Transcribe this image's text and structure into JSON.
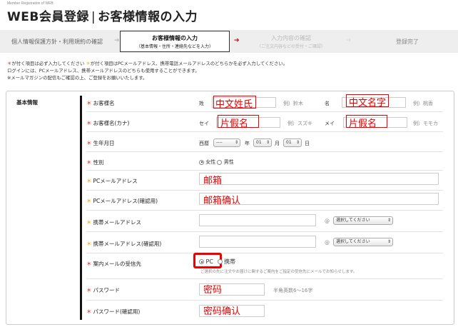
{
  "header": {
    "tiny_text": "Member Registration of WEB",
    "title_left": "WEB会員登録",
    "title_sep": "|",
    "title_right": "お客様情報の入力"
  },
  "steps": [
    {
      "label": "個人情報保護方針・利用規約の確認",
      "sub": ""
    },
    {
      "label": "お客様情報の入力",
      "sub": "（基本情報・住所・連絡先などを入力）"
    },
    {
      "label": "入力内容の確認",
      "sub": "（ご注文内容などの受付・ご確認）"
    },
    {
      "label": "登録完了",
      "sub": ""
    }
  ],
  "notes": {
    "line1_a": "が付く項目は必ず入力してください",
    "line1_b": "が付く項目はPCメールアドレス、携帯電話メールアドレスのどちらかを必ず入力してください。",
    "line2": "ログインには、PCメールアドレス、携帯メールアドレスのどちらも使用することができます。",
    "line3": "※メールマガジンの配信もご確認の上、ご登録をお願いいたします。",
    "ast": "＊"
  },
  "form": {
    "section_label": "基本情報",
    "name": {
      "label": "お客様名",
      "sei": "姓",
      "mei": "名",
      "sei_value": "中文姓氏",
      "mei_value": "中文名字",
      "sei_example": "例）鈴木",
      "mei_example": "例）桃香"
    },
    "kana": {
      "label": "お客様名(カナ)",
      "sei": "セイ",
      "mei": "メイ",
      "sei_value": "片假名",
      "mei_value": "片假名",
      "sei_example": "例）スズキ",
      "mei_example": "例）モモカ"
    },
    "birth": {
      "label": "生年月日",
      "era_label": "西暦",
      "era_value": "----",
      "year": "年",
      "month_value": "01",
      "month": "月",
      "day_value": "01",
      "day": "日"
    },
    "gender": {
      "label": "性別",
      "female": "女性",
      "male": "男性"
    },
    "pc_mail": {
      "label": "PCメールアドレス",
      "value": "邮箱"
    },
    "pc_mail_confirm": {
      "label": "PCメールアドレス(確認用)",
      "value": "邮箱确认"
    },
    "mobile_mail": {
      "label": "携帯メールアドレス",
      "at": "@",
      "select": "選択してください"
    },
    "mobile_mail_confirm": {
      "label": "携帯メールアドレス(確認用)",
      "at": "@",
      "select": "選択してください"
    },
    "receive": {
      "label": "案内メールの受信先",
      "pc": "PC",
      "mobile": "携帯",
      "note": "ご選択の先に注文やお届けに関するご案内をご指定の受信先にメールでお知らせします。"
    },
    "password": {
      "label": "パスワード",
      "value": "密码",
      "hint": "半角英数6～16字"
    },
    "password_confirm": {
      "label": "パスワード(確認用)",
      "value": "密码确认"
    }
  },
  "colors": {
    "required": "#d22",
    "either": "#f0a000",
    "annotation": "#e00",
    "arrow": "#c00"
  }
}
